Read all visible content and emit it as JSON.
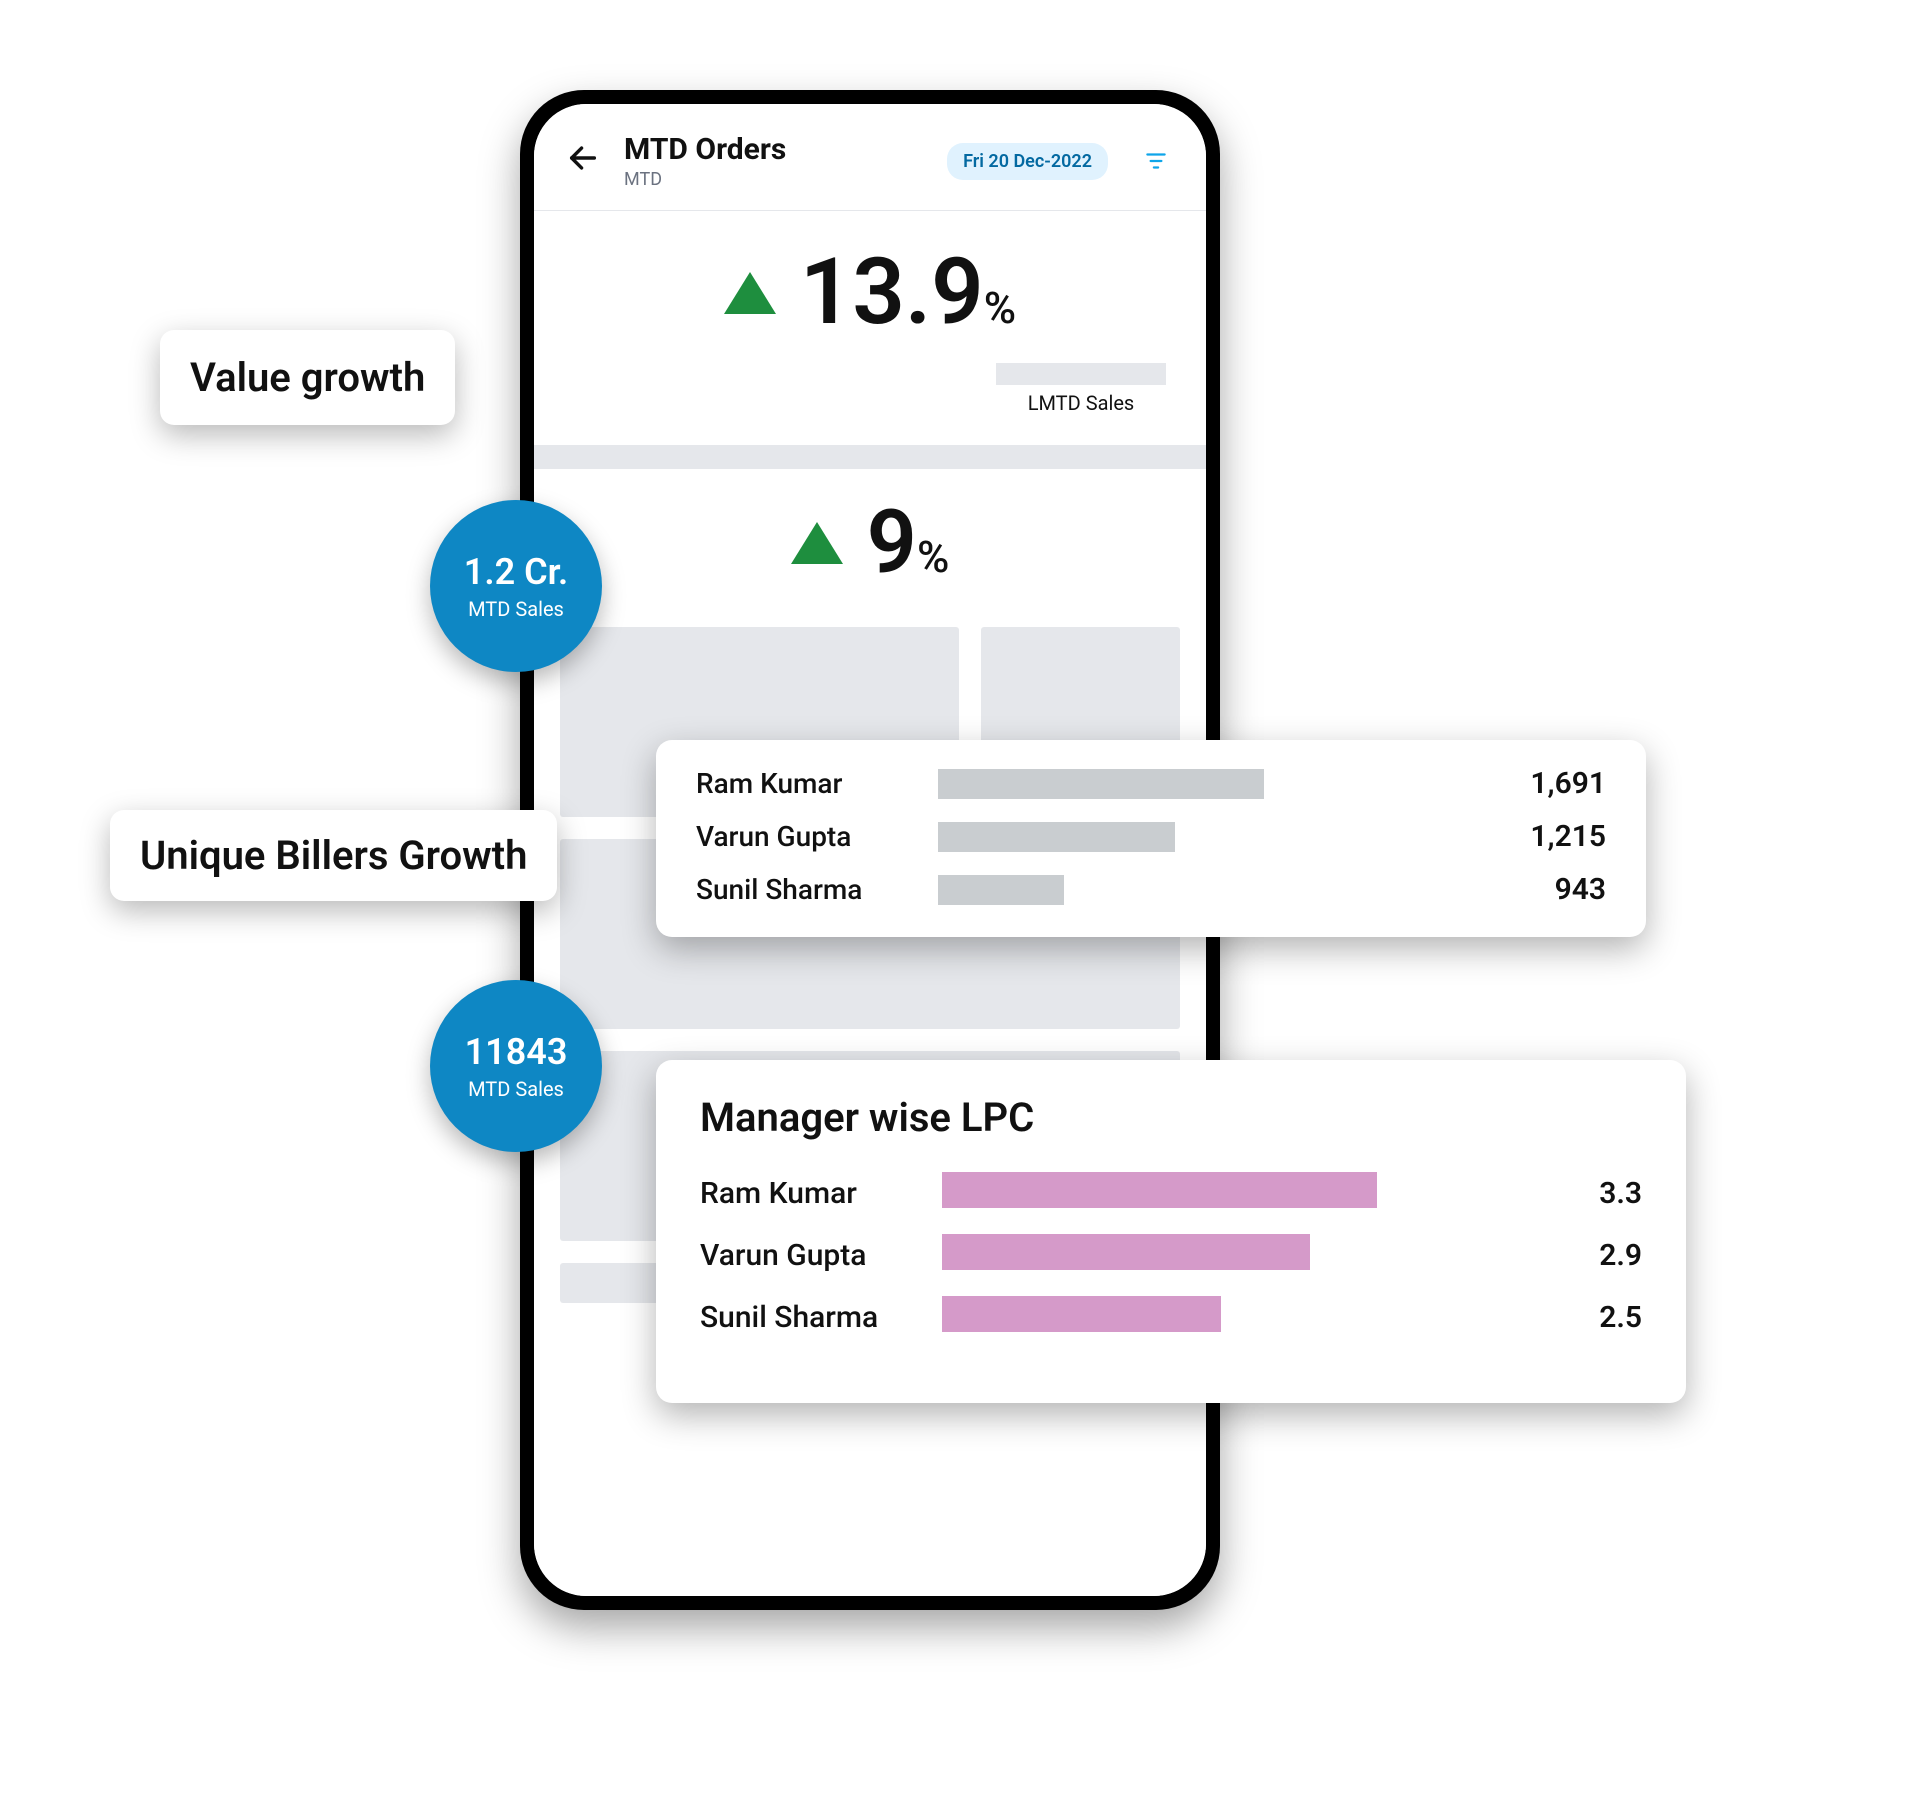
{
  "header": {
    "title": "MTD Orders",
    "subtitle": "MTD",
    "date_chip": "Fri 20 Dec-2022"
  },
  "value_growth": {
    "label": "Value growth",
    "percent": "13.9",
    "pct_sign": "%",
    "lmtd_caption": "LMTD Sales",
    "circle_value": "1.2 Cr.",
    "circle_label": "MTD Sales"
  },
  "unique_billers": {
    "label": "Unique Billers Growth",
    "percent": "9",
    "pct_sign": "%",
    "circle_value": "11843",
    "circle_label": "MTD Sales"
  },
  "chart_top": {
    "rows": [
      {
        "name": "Ram Kumar",
        "value": "1,691"
      },
      {
        "name": "Varun Gupta",
        "value": "1,215"
      },
      {
        "name": "Sunil Sharma",
        "value": "943"
      }
    ]
  },
  "chart_lpc": {
    "title": "Manager wise LPC",
    "rows": [
      {
        "name": "Ram Kumar",
        "value": "3.3"
      },
      {
        "name": "Varun Gupta",
        "value": "2.9"
      },
      {
        "name": "Sunil Sharma",
        "value": "2.5"
      }
    ]
  },
  "chart_data": [
    {
      "type": "bar",
      "title": "",
      "categories": [
        "Ram Kumar",
        "Varun Gupta",
        "Sunil Sharma"
      ],
      "values": [
        1691,
        1215,
        943
      ],
      "ylim": [
        0,
        1700
      ]
    },
    {
      "type": "bar",
      "title": "Manager wise LPC",
      "categories": [
        "Ram Kumar",
        "Varun Gupta",
        "Sunil Sharma"
      ],
      "values": [
        3.3,
        2.9,
        2.5
      ],
      "ylim": [
        0,
        3.5
      ]
    }
  ]
}
